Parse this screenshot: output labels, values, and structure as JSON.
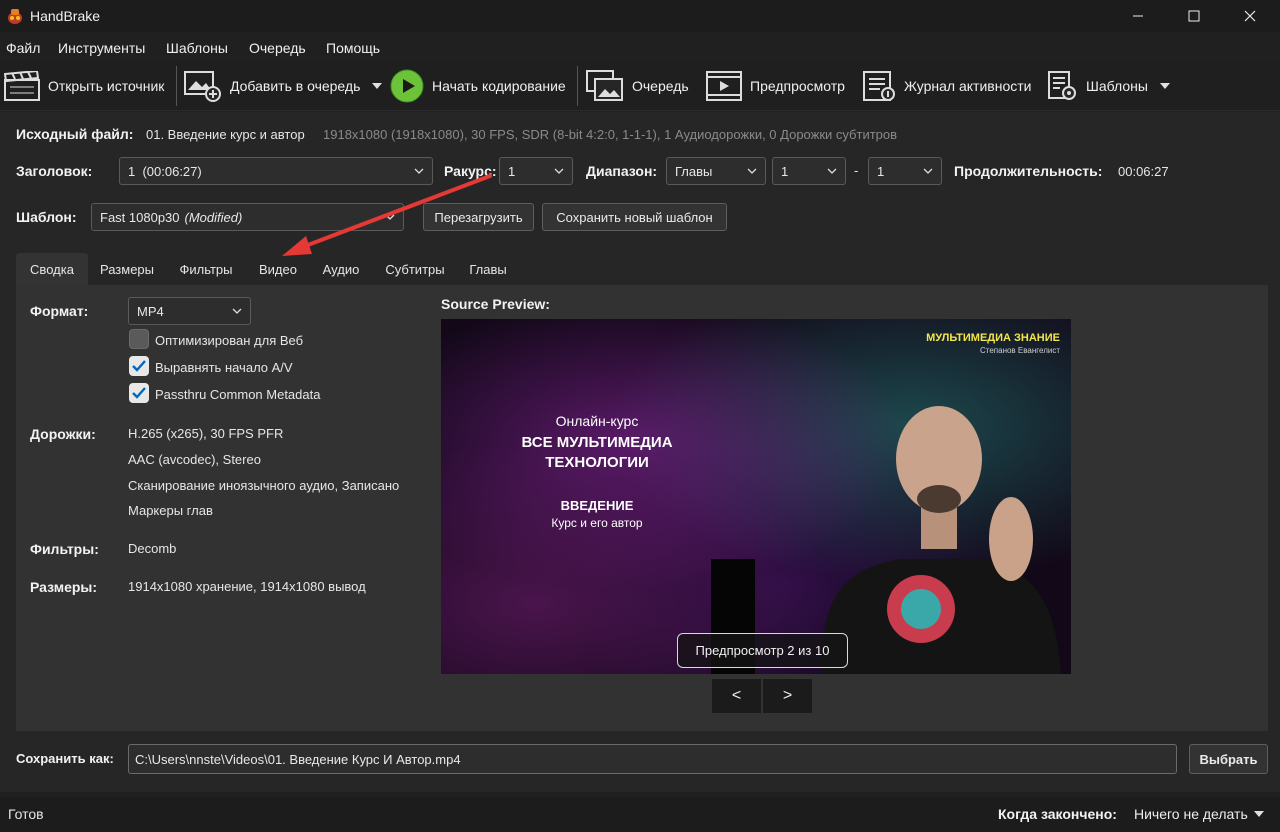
{
  "window": {
    "title": "HandBrake"
  },
  "menu": [
    "Файл",
    "Инструменты",
    "Шаблоны",
    "Очередь",
    "Помощь"
  ],
  "toolbar": {
    "open_source": "Открыть источник",
    "add_to_queue": "Добавить в очередь",
    "start_encode": "Начать кодирование",
    "queue": "Очередь",
    "preview": "Предпросмотр",
    "activity_log": "Журнал активности",
    "presets": "Шаблоны"
  },
  "source": {
    "label": "Исходный файл:",
    "name": "01. Введение курс и автор",
    "info": "1918x1080 (1918x1080), 30 FPS, SDR (8-bit 4:2:0, 1-1-1), 1 Аудиодорожки, 0 Дорожки субтитров"
  },
  "title_row": {
    "title_label": "Заголовок:",
    "title_value": "1  (00:06:27)",
    "angle_label": "Ракурс:",
    "angle_value": "1",
    "range_label": "Диапазон:",
    "range_type": "Главы",
    "range_start": "1",
    "range_sep": "-",
    "range_end": "1",
    "duration_label": "Продолжительность:",
    "duration_value": "00:06:27"
  },
  "preset_row": {
    "label": "Шаблон:",
    "value": "Fast 1080p30",
    "modified": "(Modified)",
    "reload": "Перезагрузить",
    "save_new": "Сохранить новый шаблон"
  },
  "tabs": [
    "Сводка",
    "Размеры",
    "Фильтры",
    "Видео",
    "Аудио",
    "Субтитры",
    "Главы"
  ],
  "summary": {
    "format_label": "Формат:",
    "format_value": "MP4",
    "checkboxes": [
      {
        "label": "Оптимизирован для Веб",
        "checked": false
      },
      {
        "label": "Выравнять начало A/V",
        "checked": true
      },
      {
        "label": "Passthru Common Metadata",
        "checked": true
      }
    ],
    "tracks_label": "Дорожки:",
    "tracks": [
      "H.265 (x265), 30 FPS PFR",
      "AAC (avcodec), Stereo",
      "Сканирование иноязычного аудио, Записано",
      "Маркеры глав"
    ],
    "filters_label": "Фильтры:",
    "filters_value": "Decomb",
    "dimensions_label": "Размеры:",
    "dimensions_value": "1914x1080 хранение, 1914x1080 вывод"
  },
  "preview": {
    "heading": "Source Preview:",
    "brand": "МУЛЬТИМЕДИА ЗНАНИЕ",
    "brand_sub": "Степанов Евангелист",
    "course_line": "Онлайн-курс",
    "course_title_1": "ВСЕ МУЛЬТИМЕДИА",
    "course_title_2": "ТЕХНОЛОГИИ",
    "lesson": "ВВЕДЕНИЕ",
    "lesson_sub": "Курс и его автор",
    "counter": "Предпросмотр 2 из 10",
    "prev": "<",
    "next": ">"
  },
  "save": {
    "label": "Сохранить как:",
    "path": "C:\\Users\\nnste\\Videos\\01. Введение Курс И Автор.mp4",
    "browse": "Выбрать"
  },
  "status": {
    "text": "Готов",
    "when_done_label": "Когда закончено:",
    "when_done_value": "Ничего не делать"
  },
  "colors": {
    "accent_check": "#0067c0",
    "arrow": "#e53935",
    "play": "#6cc33a"
  }
}
